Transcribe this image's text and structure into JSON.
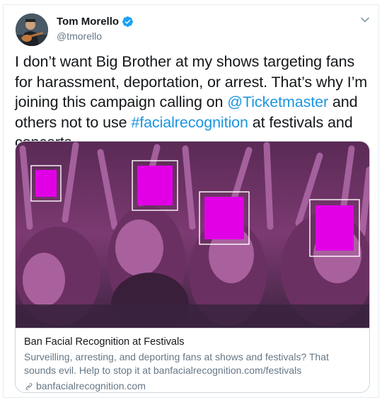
{
  "author": {
    "name": "Tom Morello",
    "handle": "@tmorello",
    "avatar_icon": "guitarist-avatar"
  },
  "tweet": {
    "text_before": "I don’t want Big Brother at my shows targeting fans for harassment, deportation, or arrest. That’s why I’m joining this campaign calling on ",
    "mention": "@Ticketmaster",
    "text_middle": " and others not to use ",
    "hashtag": "#facialrecognition",
    "text_after": " at festivals and concerts."
  },
  "card": {
    "title": "Ban Facial Recognition at Festivals",
    "description": "Surveilling, arresting, and deporting fans at shows and festivals? That sounds evil. Help to stop it at banfacialrecognition.com/festivals",
    "domain": "banfacialrecognition.com",
    "image_icon": "crowd-face-detection-image"
  },
  "colors": {
    "link": "#1b95e0",
    "verified": "#1da1f2",
    "overlay": "#8e2a8a",
    "face_highlight": "#e100e6"
  }
}
